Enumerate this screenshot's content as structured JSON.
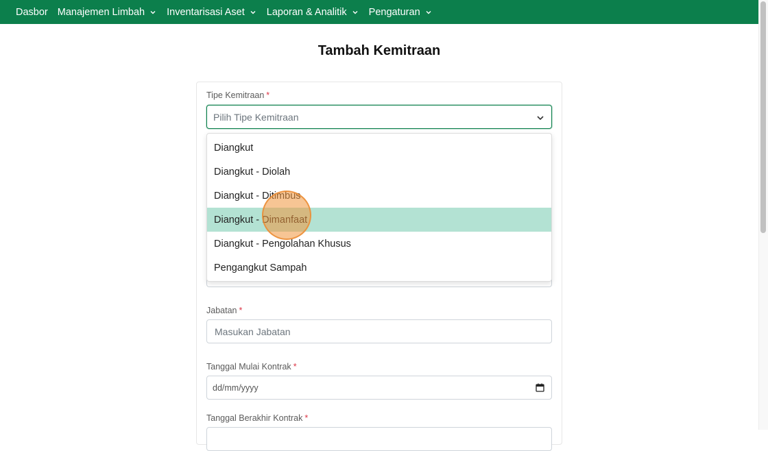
{
  "navbar": {
    "items": [
      {
        "label": "Dasbor",
        "has_dropdown": false
      },
      {
        "label": "Manajemen Limbah",
        "has_dropdown": true
      },
      {
        "label": "Inventarisasi Aset",
        "has_dropdown": true
      },
      {
        "label": "Laporan & Analitik",
        "has_dropdown": true
      },
      {
        "label": "Pengaturan",
        "has_dropdown": true
      }
    ],
    "color": "#0c7f4c"
  },
  "page": {
    "title": "Tambah Kemitraan"
  },
  "form": {
    "partnership_type": {
      "label": "Tipe Kemitraan",
      "required_mark": "*",
      "placeholder": "Pilih Tipe Kemitraan",
      "options": [
        "Diangkut",
        "Diangkut - Diolah",
        "Diangkut - Ditimbus",
        "Diangkut - Dimanfaat",
        "Diangkut - Pengolahan Khusus",
        "Pengangkut Sampah"
      ],
      "highlighted_option": "Diangkut - Dimanfaat"
    },
    "position": {
      "label": "Jabatan",
      "required_mark": "*",
      "placeholder": "Masukan Jabatan"
    },
    "contract_start": {
      "label": "Tanggal Mulai Kontrak",
      "required_mark": "*",
      "placeholder": "dd/mm/yyyy"
    },
    "contract_end": {
      "label": "Tanggal Berakhir Kontrak",
      "required_mark": "*"
    }
  },
  "colors": {
    "accent": "#0c7f4c",
    "option_highlight": "#b3e2d3",
    "required": "#dc3545"
  }
}
